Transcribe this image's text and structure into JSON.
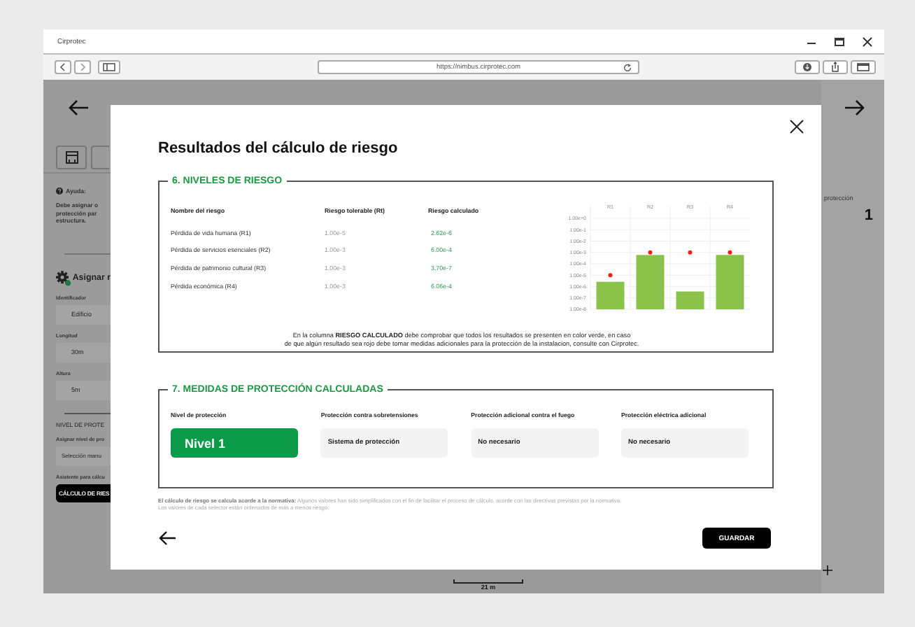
{
  "window": {
    "title": "Cirprotec",
    "url": "https://nimbus.cirprotec.com"
  },
  "background_page": {
    "help_title": "Ayuda:",
    "help_lines": [
      "Debe asignar o",
      "protección par",
      "estructura."
    ],
    "section_title": "Asignar r",
    "fields": [
      {
        "label": "Identificador",
        "value": "Edificio"
      },
      {
        "label": "Longitud",
        "value": "30m"
      },
      {
        "label": "Altura",
        "value": "5m"
      }
    ],
    "protection_title": "NIVEL DE PROTE",
    "protection_label": "Asignar nivel de pro",
    "protection_value": "Selección manu",
    "assistant_label": "Asistente para cálcu",
    "assistant_button": "CÁLCULO DE RIES",
    "right_label": "protección",
    "right_value": "1",
    "scale_label": "21 m"
  },
  "dialog": {
    "title": "Resultados del cálculo de riesgo",
    "risk_section": {
      "title": "6. NIVELES DE RIESGO",
      "columns": [
        "Nombre del riesgo",
        "Riesgo tolerable (Rt)",
        "Riesgo calculado"
      ],
      "rows": [
        {
          "name": "Pérdida de vida humana (R1)",
          "tolerable": "1.00e-5",
          "calculated": "2.62e-6",
          "ok": true
        },
        {
          "name": "Pérdida de servicios esenciales (R2)",
          "tolerable": "1.00e-3",
          "calculated": "6.00e-4",
          "ok": true
        },
        {
          "name": "Pérdida de patrimonio cultural (R3)",
          "tolerable": "1.00e-3",
          "calculated": "3.70e-7",
          "ok": true
        },
        {
          "name": "Pérdida económica (R4)",
          "tolerable": "1.00e-3",
          "calculated": "6.06e-4",
          "ok": true
        }
      ],
      "risk_chart": {
        "categories": [
          "R1",
          "R2",
          "R3",
          "R4"
        ],
        "axis_labels": [
          "1.00e+0",
          "1.00e-1",
          "1.00e-2",
          "1.00e-3",
          "1.00e-4",
          "1.00e-5",
          "1.00e-6",
          "1.00e-7",
          "1.00e-8"
        ]
      },
      "note_lines": [
        "En la columna **RIESGO CALCULADO** debe comprobar que todos los resultados se presenten en color verde, en caso",
        "de que algún resultado sea rojo debe tomar medidas adicionales para la protección de la instalacion, consulte con Cirprotec."
      ]
    },
    "protection_section": {
      "title": "7. MEDIDAS DE PROTECCIÓN CALCULADAS",
      "items": [
        {
          "label": "Nivel de protección",
          "value": "Nivel 1",
          "kind": "level"
        },
        {
          "label": "Protección contra sobretensiones",
          "value": "Sistema de protección",
          "kind": "result"
        },
        {
          "label": "Protección adicional contra el fuego",
          "value": "No necesario",
          "kind": "result"
        },
        {
          "label": "Protección eléctrica adicional",
          "value": "No necesario",
          "kind": "result"
        }
      ]
    },
    "footnote_lines": [
      "**El cálculo de riesgo se calcula acorde a la normativa:** Algunos valores han sido simplificados con el fin de facilitar el proceso de cálculo, acorde con las directivas previstas por la normativa.",
      "Los valores de cada selector están ordenados de más a menos riesgo."
    ],
    "save_button": "GUARDAR"
  }
}
